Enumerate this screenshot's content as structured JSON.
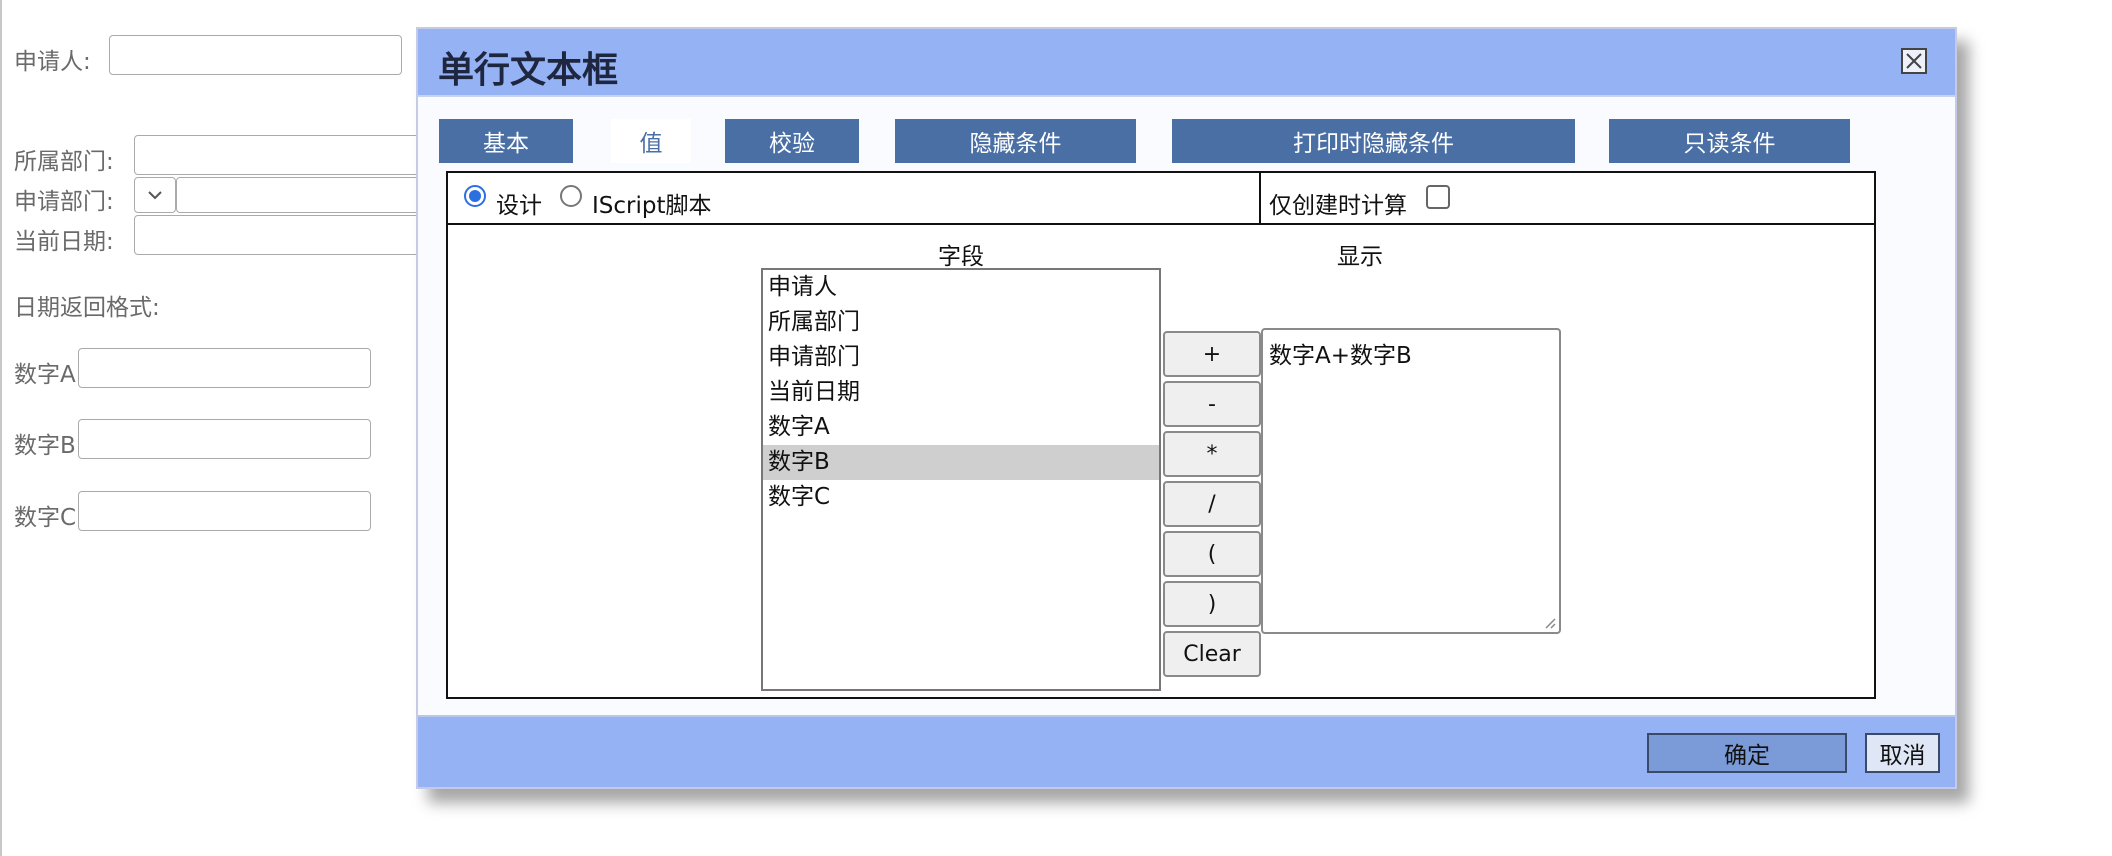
{
  "form": {
    "applicant_label": "申请人:",
    "department_label": "所属部门:",
    "apply_department_label": "申请部门:",
    "current_date_label": "当前日期:",
    "date_format_label": "日期返回格式:",
    "number_a_label": "数字A",
    "number_b_label": "数字B",
    "number_c_label": "数字C"
  },
  "dialog": {
    "title": "单行文本框",
    "tabs": [
      {
        "label": "基本"
      },
      {
        "label": "值"
      },
      {
        "label": "校验"
      },
      {
        "label": "隐藏条件"
      },
      {
        "label": "打印时隐藏条件"
      },
      {
        "label": "只读条件"
      }
    ],
    "active_tab": "值",
    "mode_design_label": "设计",
    "mode_script_label": "IScript脚本",
    "selected_mode": "设计",
    "create_only_label": "仅创建时计算",
    "create_only_checked": false,
    "field_header": "字段",
    "display_header": "显示",
    "fields": [
      "申请人",
      "所属部门",
      "申请部门",
      "当前日期",
      "数字A",
      "数字B",
      "数字C"
    ],
    "selected_field": "数字B",
    "operators": [
      "+",
      "-",
      "*",
      "/",
      "(",
      ")",
      "Clear"
    ],
    "display_value": "数字A+数字B",
    "ok_label": "确定",
    "cancel_label": "取消"
  },
  "colors": {
    "titlebar": "#95b2f5",
    "tab": "#4a6fa5",
    "ok_button": "#7b9ad8"
  },
  "icons": {
    "close": "close-icon",
    "dropdown": "chevron-down-icon",
    "resize": "resize-grip-icon"
  }
}
